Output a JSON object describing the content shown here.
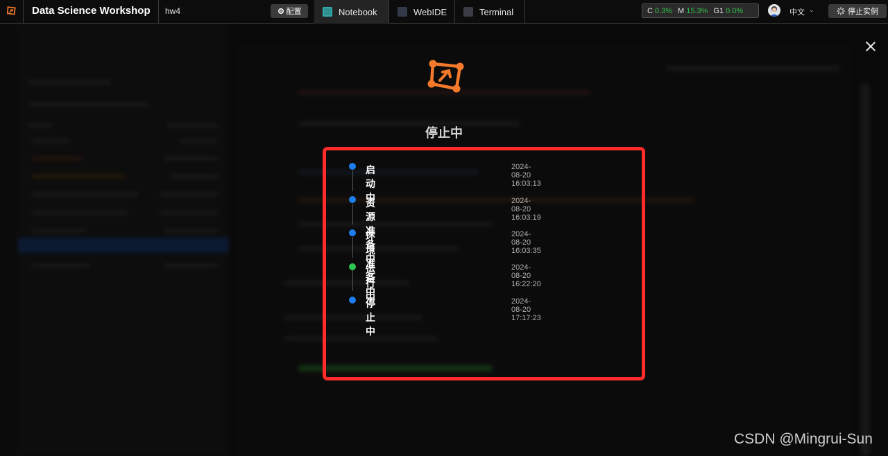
{
  "header": {
    "app_title": "Data Science Workshop",
    "project": "hw4",
    "config_label": "配置",
    "tabs": [
      {
        "label": "Notebook",
        "icon": "notebook-icon",
        "active": true
      },
      {
        "label": "WebIDE",
        "icon": "code-icon",
        "active": false
      },
      {
        "label": "Terminal",
        "icon": "terminal-icon",
        "active": false
      }
    ],
    "stats": {
      "cpu_label": "C",
      "cpu_value": "0.3%",
      "mem_label": "M",
      "mem_value": "15.3%",
      "gpu_label": "G1",
      "gpu_value": "0.0%"
    },
    "language": "中文",
    "stop_label": "停止实例"
  },
  "modal": {
    "status_title": "停止中",
    "timeline": [
      {
        "label": "启动中",
        "time": "2024-08-20 16:03:13",
        "color": "#1e7ef0"
      },
      {
        "label": "资源准备中",
        "time": "2024-08-20 16:03:19",
        "color": "#1e7ef0"
      },
      {
        "label": "环境准备中",
        "time": "2024-08-20 16:03:35",
        "color": "#1e7ef0"
      },
      {
        "label": "运行中",
        "time": "2024-08-20 16:22:20",
        "color": "#2dc653"
      },
      {
        "label": "停止中",
        "time": "2024-08-20 17:17:23",
        "color": "#1e7ef0"
      }
    ]
  },
  "colors": {
    "brand_orange": "#f5792a",
    "highlight_red": "#ff2a2a",
    "stat_green": "#33c24d"
  },
  "watermark": "CSDN @Mingrui-Sun"
}
